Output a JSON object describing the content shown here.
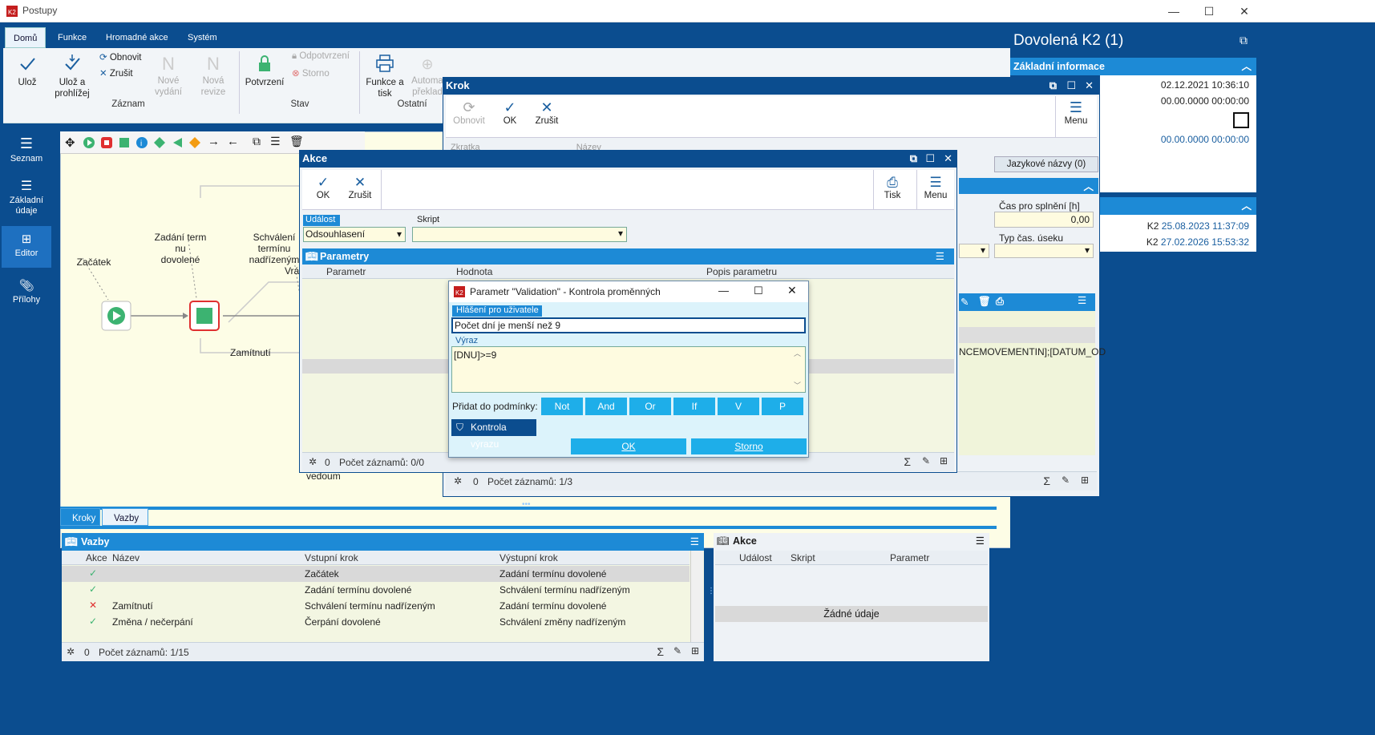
{
  "window": {
    "title": "Postupy",
    "min": "—",
    "max": "☐",
    "close": "✕"
  },
  "ribbon": {
    "tabs": [
      "Domů",
      "Funkce",
      "Hromadné akce",
      "Systém"
    ],
    "buttons": {
      "save": "Ulož",
      "save_view_1": "Ulož a",
      "save_view_2": "prohlížej",
      "refresh": "Obnovit",
      "cancel": "Zrušit",
      "new_edition_1": "Nové",
      "new_edition_2": "vydání",
      "new_revision_1": "Nová",
      "new_revision_2": "revize",
      "confirm": "Potvrzení",
      "unconfirm": "Odpotvrzení",
      "storno": "Storno",
      "print_1": "Funkce a",
      "print_2": "tisk",
      "auto_1": "Automa",
      "auto_2": "překlad"
    },
    "groups": [
      "Záznam",
      "Stav",
      "Ostatní"
    ]
  },
  "leftnav": [
    {
      "label_1": "Seznam",
      "label_2": ""
    },
    {
      "label_1": "Základní",
      "label_2": "údaje"
    },
    {
      "label_1": "Editor",
      "label_2": ""
    },
    {
      "label_1": "Přílohy",
      "label_2": ""
    }
  ],
  "diagram": {
    "labels": {
      "start": "Začátek",
      "entry_1": "Zadání term nu",
      "entry_2": "dovolené",
      "approve_1": "Schválení",
      "approve_2": "termínu",
      "approve_3": "nadřízeným",
      "return": "Vrá",
      "reject": "Zamítnutí",
      "note": "vedoum"
    }
  },
  "right_panel": {
    "title": "Dovolená K2 (1)",
    "section_basic": "Základní informace",
    "date1": "02.12.2021 10:36:10",
    "date2": "00.00.0000 00:00:00",
    "date3": "00.00.0000 00:00:00",
    "lang_button": "Jazykové názvy (0)",
    "time_label": "Čas pro splnění [h]",
    "time_value": "0,00",
    "period_label": "Typ čas. úseku",
    "k2_1_user": "K2",
    "k2_1_date": "25.08.2023 11:37:09",
    "k2_2_user": "K2",
    "k2_2_date": "27.02.2026 15:53:32"
  },
  "krok": {
    "title": "Krok",
    "refresh": "Obnovit",
    "ok": "OK",
    "cancel": "Zrušit",
    "menu": "Menu",
    "header_cut_1": "Zkratka",
    "header_cut_2": "Název",
    "expr_text": "NCEMOVEMENTIN];[DATUM_OD",
    "status_count": "0",
    "status_text": "Počet záznamů: 1/3"
  },
  "akce": {
    "title": "Akce",
    "ok": "OK",
    "cancel": "Zrušit",
    "print": "Tisk",
    "menu": "Menu",
    "event_label": "Událost",
    "event_value": "Odsouhlasení",
    "script_label": "Skript",
    "script_value": "",
    "params_title": "Parametry",
    "cols": [
      "Parametr",
      "Hodnota",
      "Popis parametru"
    ],
    "status_count": "0",
    "status_text": "Počet záznamů: 0/0"
  },
  "param_dialog": {
    "title": "Parametr \"Validation\" - Kontrola proměnných",
    "msg_label": "Hlášení pro uživatele",
    "msg_value": "Počet dní je menší než 9",
    "expr_label": "Výraz",
    "expr_value": "[DNU]>=9",
    "add_label": "Přidat do podmínky:",
    "cond_buttons": [
      "Not",
      "And",
      "Or",
      "If",
      "V",
      "P"
    ],
    "check_button": "Kontrola výrazu",
    "ok": "OK",
    "storno": "Storno"
  },
  "bottom": {
    "tabs": [
      "Kroky",
      "Vazby"
    ],
    "vazby": {
      "title": "Vazby",
      "cols": [
        "Akce",
        "Název",
        "Vstupní krok",
        "Výstupní krok"
      ],
      "rows": [
        {
          "icon": "check",
          "name": "",
          "in": "Začátek",
          "out": "Zadání termínu dovolené"
        },
        {
          "icon": "check",
          "name": "",
          "in": "Zadání termínu dovolené",
          "out": "Schválení termínu nadřízeným"
        },
        {
          "icon": "cross",
          "name": "Zamítnutí",
          "in": "Schválení termínu nadřízeným",
          "out": "Zadání termínu dovolené"
        },
        {
          "icon": "check",
          "name": "Změna / nečerpání",
          "in": "Čerpání dovolené",
          "out": "Schválení změny nadřízeným"
        }
      ],
      "status_count": "0",
      "status_text": "Počet záznamů: 1/15"
    },
    "akce": {
      "title": "Akce",
      "cols": [
        "Událost",
        "Skript",
        "Parametr"
      ],
      "empty": "Žádné údaje"
    }
  },
  "colors": {
    "brand": "#0b4d8f",
    "accent": "#1eaee9",
    "header": "#1d8ad6"
  }
}
